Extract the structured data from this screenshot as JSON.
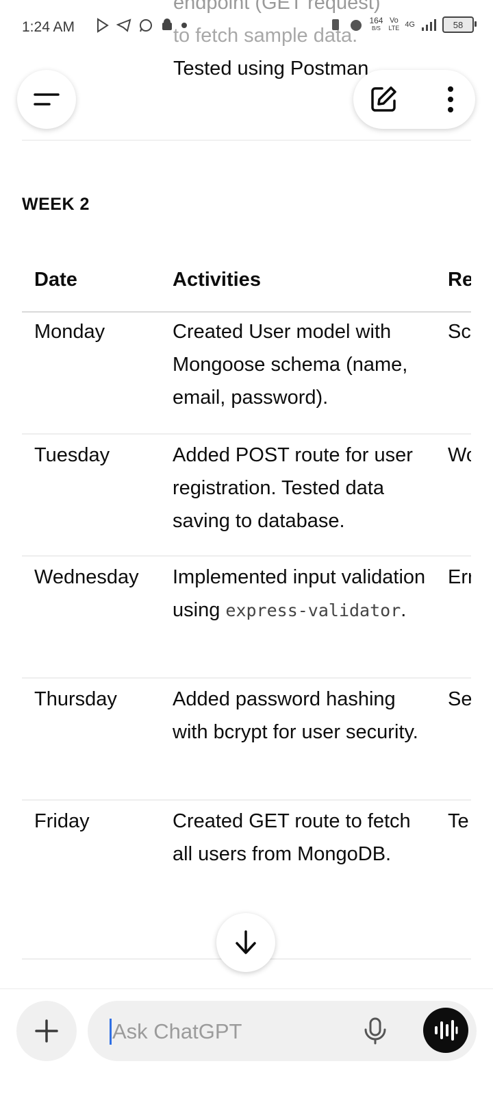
{
  "status_bar": {
    "time": "1:24 AM",
    "net_speed_value": "164",
    "net_speed_unit": "B/S",
    "volte_top": "Vo",
    "volte_bottom": "LTE",
    "network": "4G",
    "battery": "58"
  },
  "previous_message": {
    "line1": "endpoint (GET request)",
    "line2": "to fetch sample data.",
    "line3": "Tested using Postman."
  },
  "week_heading": "WEEK 2",
  "table": {
    "headers": {
      "date": "Date",
      "activities": "Activities",
      "results": "Re"
    },
    "rows": [
      {
        "date": "Monday",
        "activities": "Created User model with Mongoose schema (name, email, password).",
        "results": "Sc"
      },
      {
        "date": "Tuesday",
        "activities": "Added POST route for user registration. Tested data saving to database.",
        "results": "Wo"
      },
      {
        "date": "Wednesday",
        "activities_prefix": "Implemented input validation using",
        "activities_code": "express-validator",
        "activities_suffix": ".",
        "results": "Err"
      },
      {
        "date": "Thursday",
        "activities": "Added password hashing with bcrypt for user security.",
        "results": "Se"
      },
      {
        "date": "Friday",
        "activities": "Created GET route to fetch all users from MongoDB.",
        "results": "Te"
      }
    ]
  },
  "composer": {
    "placeholder": "Ask ChatGPT"
  },
  "icons": {
    "menu": "menu-icon",
    "edit": "new-chat-edit-icon",
    "more": "more-vertical-icon",
    "scroll_down": "arrow-down-icon",
    "plus": "plus-icon",
    "mic": "microphone-icon",
    "voice": "voice-mode-icon"
  }
}
